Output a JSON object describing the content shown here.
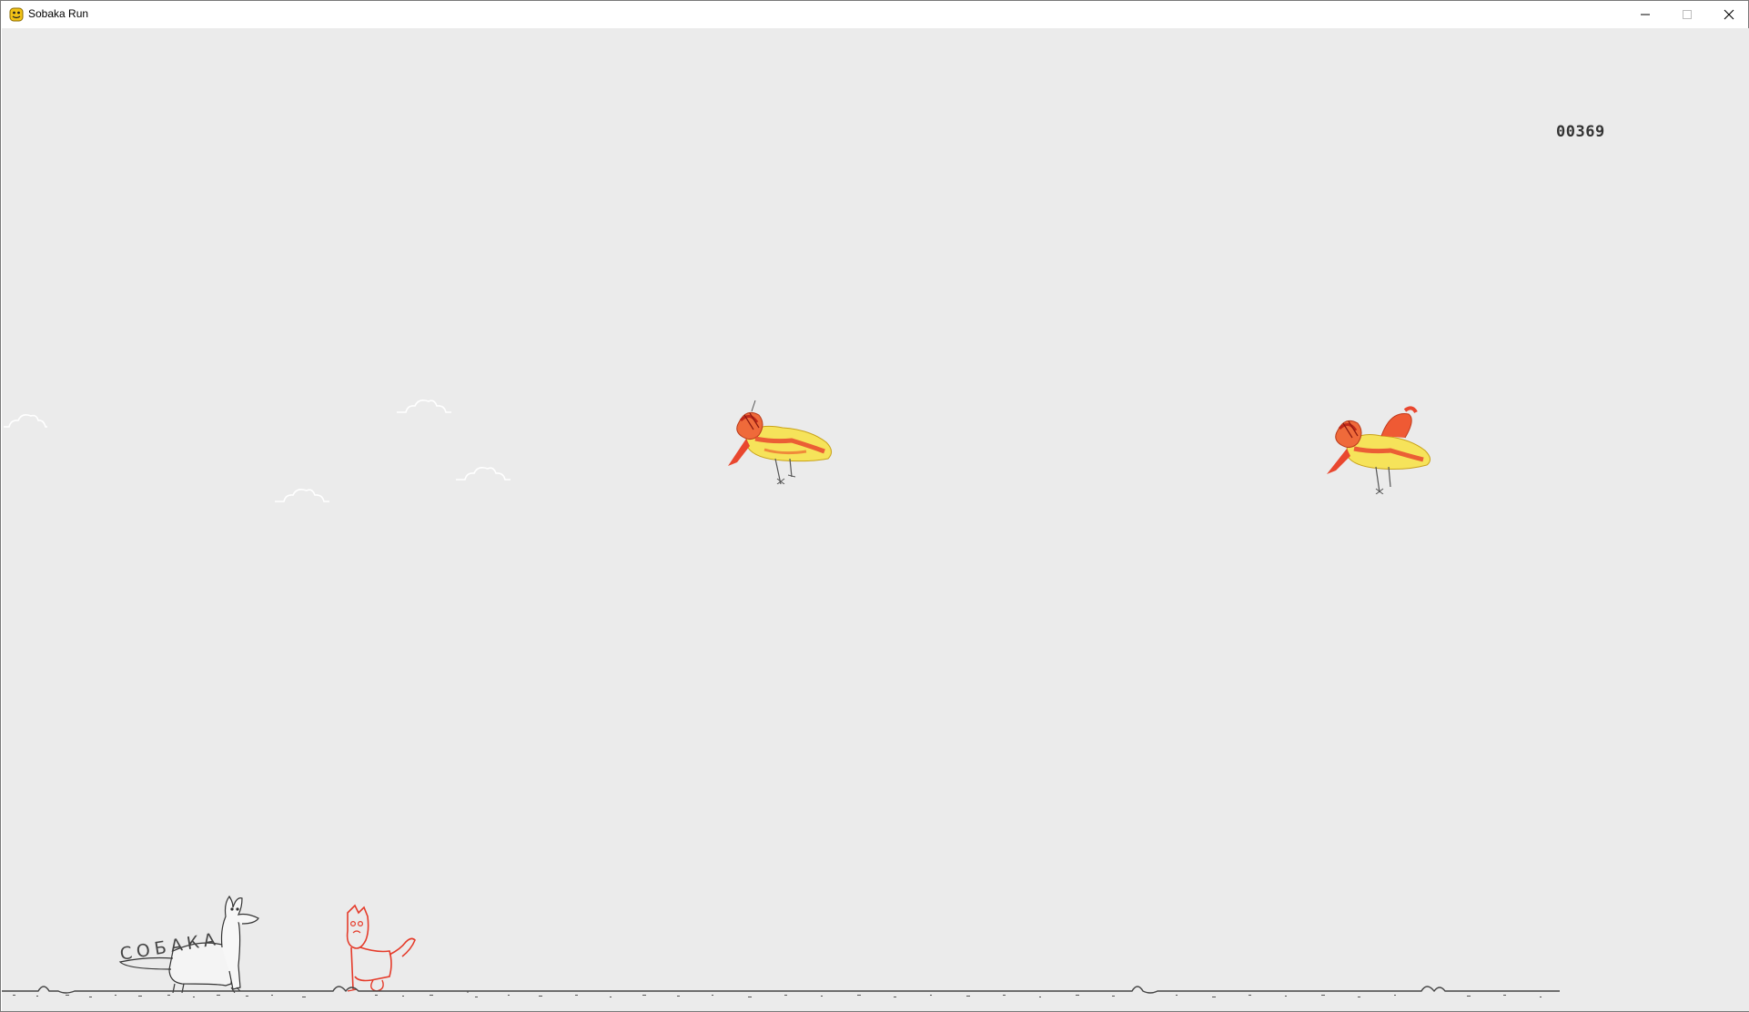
{
  "window": {
    "title": "Sobaka Run",
    "controls": {
      "minimize": "minimize-icon",
      "maximize": "maximize-icon",
      "close": "close-icon"
    }
  },
  "game": {
    "score": "00369",
    "dog_label": "СОБАКА",
    "colors": {
      "background": "#ebebeb",
      "bird_body": "#f6e35a",
      "bird_accent": "#e9472f",
      "cat": "#e53b2a",
      "ground": "#444444",
      "cloud": "#ffffff"
    }
  }
}
